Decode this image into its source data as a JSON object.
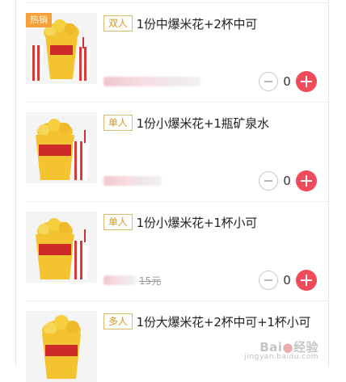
{
  "items": [
    {
      "hot_tag": "热销",
      "type_tag": "双人",
      "title": "1份中爆米花+2杯中可",
      "old_price": "",
      "quantity": "0",
      "image": "popcorn-two-cups"
    },
    {
      "hot_tag": "",
      "type_tag": "单人",
      "title": "1份小爆米花+1瓶矿泉水",
      "old_price": "",
      "quantity": "0",
      "image": "popcorn-one-cup"
    },
    {
      "hot_tag": "",
      "type_tag": "单人",
      "title": "1份小爆米花+1杯小可",
      "old_price": "15元",
      "quantity": "0",
      "image": "popcorn-one-cup"
    },
    {
      "hot_tag": "",
      "type_tag": "多人",
      "title": "1份大爆米花+2杯中可+1杯小可",
      "old_price": "",
      "quantity": "",
      "image": "popcorn-bucket"
    }
  ],
  "watermark": {
    "brand_left": "Bai",
    "brand_right": "经验",
    "sub": "jingyan.baidu.com"
  }
}
